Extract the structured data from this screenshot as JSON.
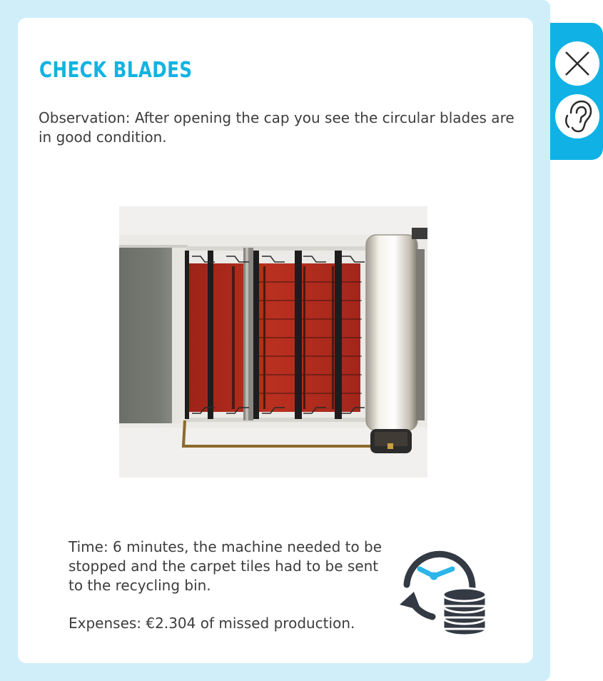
{
  "dialog": {
    "title": "CHECK BLADES",
    "observation": "Observation: After opening the cap you see the circular blades are in good condition.",
    "time_text": "Time: 6 minutes, the machine needed to be stopped and the carpet tiles had to be sent to the recycling bin.",
    "expenses_text": "Expenses: €2.304 of missed production."
  },
  "side_buttons": {
    "close_icon": "close-icon",
    "listen_icon": "ear-icon"
  },
  "colors": {
    "accent": "#12b3e2",
    "frame": "#cfeef9",
    "text": "#3d3d3d",
    "icon_dark": "#333a44",
    "clock_hands": "#2cb5e8",
    "carpet_red": "#b22a20"
  }
}
